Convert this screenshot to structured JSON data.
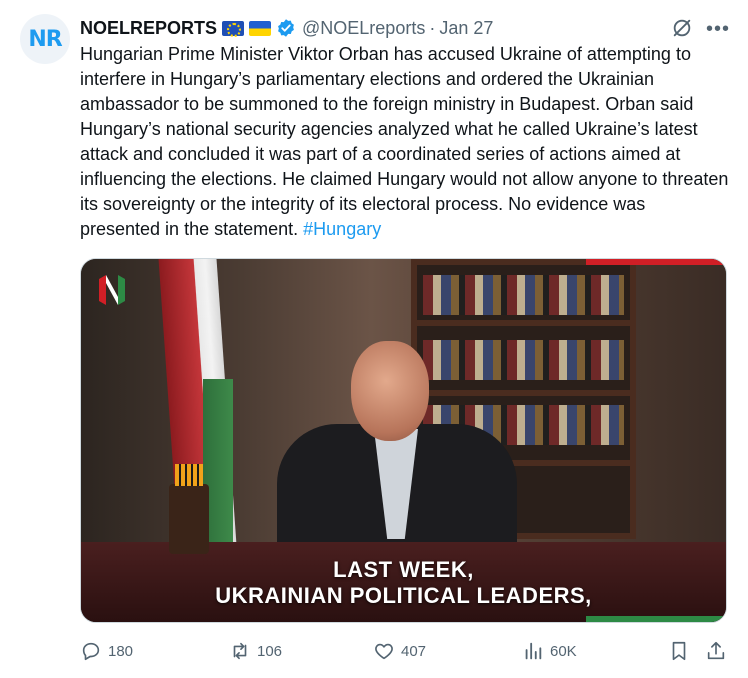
{
  "author": {
    "name": "NOELREPORTS",
    "avatar_text": "NR",
    "flags": [
      "eu-flag",
      "ukraine-flag"
    ],
    "verified": true,
    "handle": "@NOELreports",
    "separator": "·",
    "date": "Jan 27"
  },
  "tweet": {
    "text": "Hungarian Prime Minister Viktor Orban has accused Ukraine of attempting to interfere in Hungary’s parliamentary elections and ordered the Ukrainian ambassador to be summoned to the foreign ministry in Budapest. Orban said Hungary’s national security agencies analyzed what he called Ukraine’s latest attack and concluded it was part of a coordinated series of actions aimed at influencing the elections. He claimed Hungary would not allow anyone to threaten its sovereignty or the integrity of its electoral process. No evidence was presented in the statement.",
    "hashtag": "#Hungary"
  },
  "media": {
    "caption_line1": "LAST WEEK,",
    "caption_line2": "UKRAINIAN POLITICAL LEADERS,"
  },
  "actions": {
    "replies": "180",
    "reposts": "106",
    "likes": "407",
    "views": "60K"
  },
  "colors": {
    "text": "#0f1419",
    "secondary": "#536471",
    "link": "#1d9bf0",
    "verified": "#1d9bf0"
  }
}
